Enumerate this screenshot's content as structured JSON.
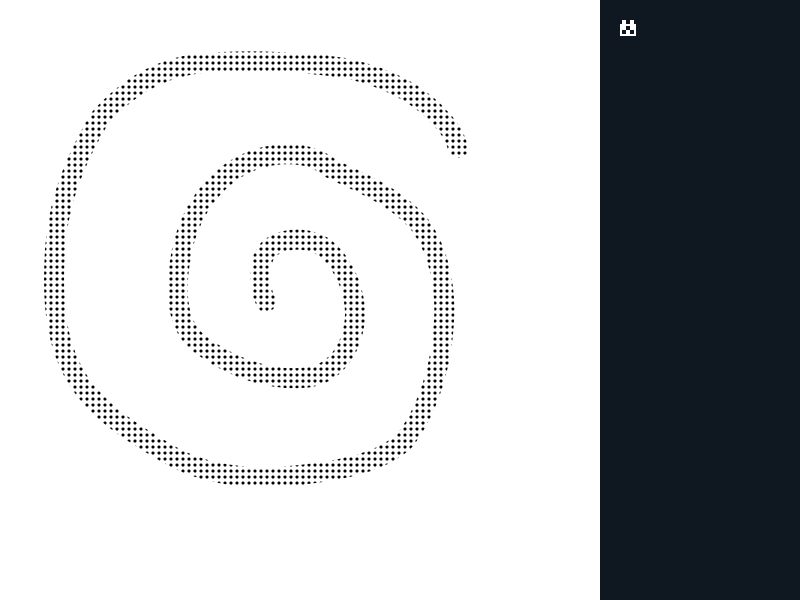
{
  "canvas": {
    "background": "#ffffff",
    "pattern": "halftone-dots",
    "pattern_color": "#000000",
    "shape": "spiral"
  },
  "side_panel": {
    "background": "#0f1720",
    "icon": "pixel-logo-icon",
    "icon_color": "#ffffff"
  }
}
